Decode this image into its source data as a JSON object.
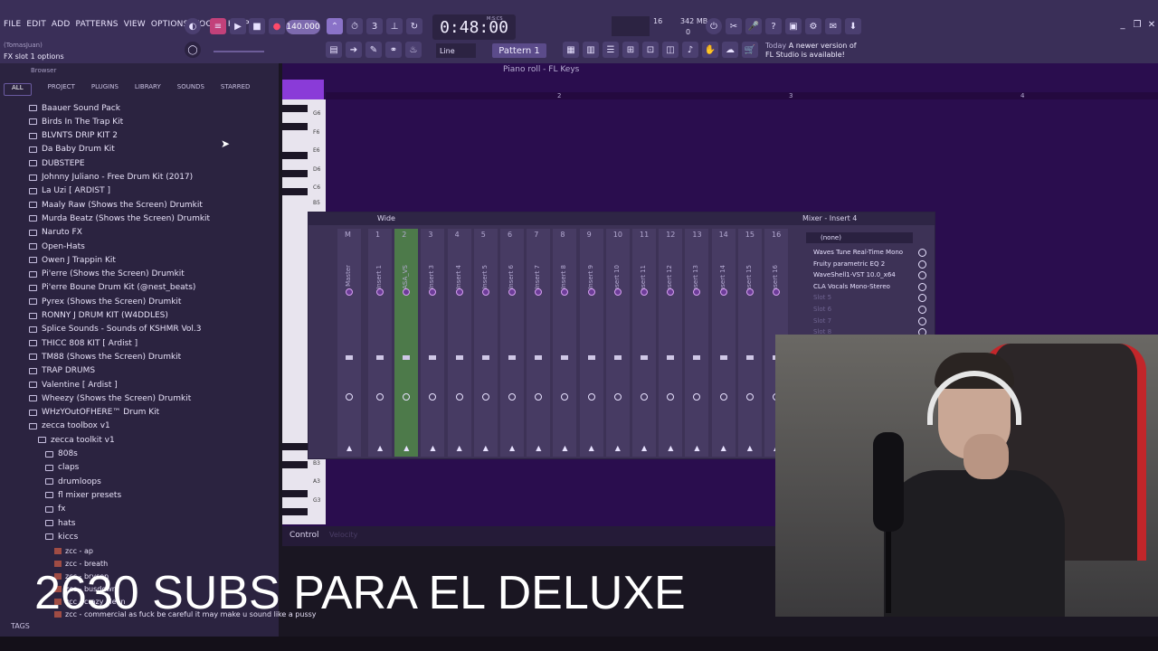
{
  "menu": [
    "FILE",
    "EDIT",
    "ADD",
    "PATTERNS",
    "VIEW",
    "OPTIONS",
    "TOOLS",
    "HELP"
  ],
  "hint_user": "(TomasJuan)",
  "hint": "FX slot 1 options",
  "tempo": "140.000",
  "time": "0:48:00",
  "time_unit": "M:S:CS",
  "cpu": "16",
  "memory": "342 MB",
  "polyphony": "0",
  "snap": "Line",
  "pattern": "Pattern 1",
  "news": {
    "date": "Today",
    "line1": "A newer version of",
    "line2": "FL Studio is available!"
  },
  "browser": {
    "title": "Browser",
    "tabs": [
      "ALL",
      "PROJECT",
      "PLUGINS",
      "LIBRARY",
      "SOUNDS",
      "STARRED"
    ],
    "items": [
      "Baauer Sound Pack",
      "Birds In The Trap Kit",
      "BLVNTS DRIP KIT 2",
      "Da Baby Drum Kit",
      "DUBSTEPE",
      "Johnny Juliano - Free Drum Kit (2017)",
      "La Uzi [ ARDIST ]",
      "Maaly Raw (Shows the Screen) Drumkit",
      "Murda Beatz (Shows the Screen) Drumkit",
      "Naruto FX",
      "Open-Hats",
      "Owen J Trappin Kit",
      "Pi'erre (Shows the Screen) Drumkit",
      "Pi'erre Boune Drum Kit (@nest_beats)",
      "Pyrex (Shows the Screen) Drumkit",
      "RONNY J DRUM KIT (W4DDLES)",
      "Splice Sounds - Sounds of KSHMR Vol.3",
      "THICC 808 KIT [ Ardist ]",
      "TM88 (Shows the Screen) Drumkit",
      "TRAP DRUMS",
      "Valentine [ Ardist ]",
      "Wheezy (Shows the Screen) Drumkit",
      "WHzYOutOFHERE™ Drum Kit",
      "zecca toolbox v1",
      "zecca toolkit v1",
      "808s",
      "claps",
      "drumloops",
      "fl mixer presets",
      "fx",
      "hats",
      "kiccs"
    ],
    "files": [
      "zcc - ap",
      "zcc - breath",
      "zcc - bryson",
      "zcc - busdown",
      "zcc - crazy clean",
      "zcc - commercial as fuck be careful it may make u sound like a pussy"
    ],
    "tags": "TAGS"
  },
  "piano_roll": {
    "title": "Piano roll - FL Keys",
    "ruler": [
      "2",
      "3",
      "4"
    ],
    "keys": [
      "G6",
      "F6",
      "E6",
      "D6",
      "C6",
      "B5",
      "B3",
      "A3",
      "G3"
    ]
  },
  "control": {
    "label": "Control",
    "sub": "Velocity"
  },
  "mixer": {
    "view": "Wide",
    "title": "Mixer - Insert 4",
    "strips": [
      "Master",
      "Insert 1",
      "ASA_VS",
      "Insert 3",
      "Insert 4",
      "Insert 5",
      "Insert 6",
      "Insert 7",
      "Insert 8",
      "Insert 9",
      "Insert 10",
      "Insert 11",
      "Insert 12",
      "Insert 13",
      "Insert 14",
      "Insert 15",
      "Insert 16"
    ],
    "strip_numbers": [
      "C",
      "M",
      "1",
      "2",
      "3",
      "4",
      "5",
      "6",
      "7",
      "8",
      "9",
      "10",
      "11",
      "12",
      "13",
      "14",
      "15",
      "16"
    ],
    "input": "(none)",
    "fx_slots": [
      "Waves Tune Real-Time Mono",
      "Fruity parametric EQ 2",
      "WaveShell1-VST 10.0_x64",
      "CLA Vocals Mono-Stereo",
      "Slot 5",
      "Slot 6",
      "Slot 7",
      "Slot 8"
    ]
  },
  "overlay": "2630 SUBS PARA EL DELUXE"
}
